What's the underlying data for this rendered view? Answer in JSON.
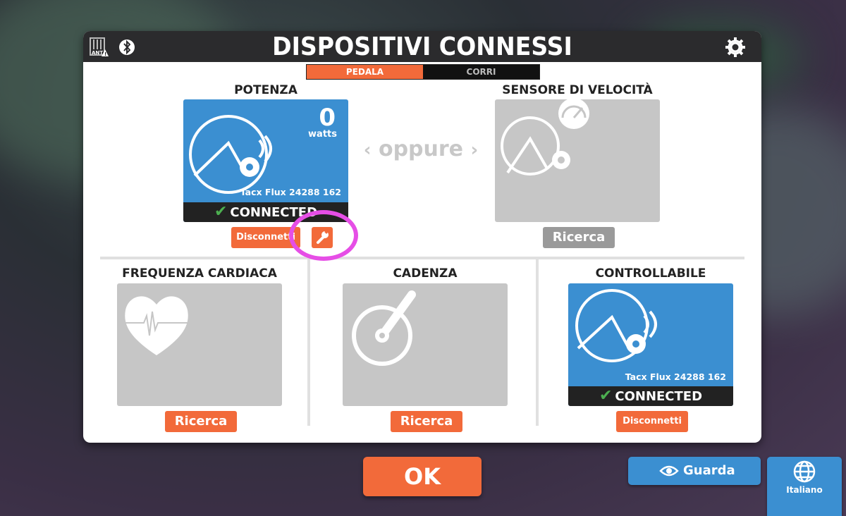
{
  "header": {
    "title": "DISPOSITIVI CONNESSI",
    "ant_label": "ANT",
    "icons": [
      "ant-plus-icon",
      "bluetooth-icon",
      "gear-icon"
    ]
  },
  "tabs": [
    {
      "label": "PEDALA",
      "active": true
    },
    {
      "label": "CORRI",
      "active": false
    }
  ],
  "power": {
    "label": "POTENZA",
    "value": "0",
    "unit": "watts",
    "device": "Tacx Flux 24288 162",
    "status": "CONNECTED",
    "disconnect_label": "Disconnetti",
    "settings_icon": "wrench-icon"
  },
  "or_label": "oppure",
  "speed": {
    "label": "SENSORE DI VELOCITÀ",
    "search_label": "Ricerca"
  },
  "heart_rate": {
    "label": "FREQUENZA CARDIACA",
    "search_label": "Ricerca"
  },
  "cadence": {
    "label": "CADENZA",
    "search_label": "Ricerca"
  },
  "controllable": {
    "label": "CONTROLLABILE",
    "device": "Tacx Flux 24288 162",
    "status": "CONNECTED",
    "disconnect_label": "Disconnetti"
  },
  "footer": {
    "ok_label": "OK",
    "watch_label": "Guarda",
    "language_label": "Italiano"
  },
  "colors": {
    "accent_orange": "#f26a3a",
    "accent_blue": "#3b8fd1",
    "header_dark": "#2b2b2d",
    "card_gray": "#c6c6c6",
    "check_green": "#4caf50",
    "highlight_magenta": "#e64ee6"
  }
}
